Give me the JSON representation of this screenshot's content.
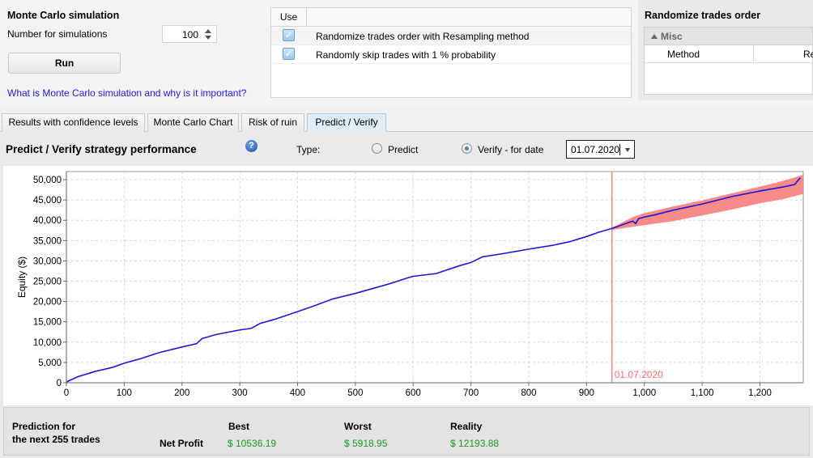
{
  "monte_carlo": {
    "title": "Monte Carlo simulation",
    "num_label": "Number for simulations",
    "num_value": "100",
    "run_label": "Run",
    "link_text": "What is Monte Carlo simulation and why is it important?"
  },
  "use_table": {
    "header_use": "Use",
    "rows": [
      {
        "checked": true,
        "label": "Randomize trades order with Resampling method"
      },
      {
        "checked": true,
        "label": "Randomly skip trades with 1 % probability"
      }
    ]
  },
  "randomize_panel": {
    "title": "Randomize trades order",
    "group": "Misc",
    "property_key": "Method",
    "property_value": "Re"
  },
  "tabs": [
    {
      "label": "Results with confidence levels",
      "active": false
    },
    {
      "label": "Monte Carlo Chart",
      "active": false
    },
    {
      "label": "Risk of ruin",
      "active": false
    },
    {
      "label": "Predict / Verify",
      "active": true
    }
  ],
  "predict": {
    "title": "Predict / Verify strategy performance",
    "help_glyph": "?",
    "type_label": "Type:",
    "option_predict": "Predict",
    "option_verify": "Verify - for date",
    "selected": "verify",
    "date_value": "01.07.2020"
  },
  "chart_data": {
    "type": "area",
    "ylabel": "Equity ($)",
    "xlabel": "",
    "xlim": [
      0,
      1275
    ],
    "ylim": [
      0,
      52000
    ],
    "xticks": [
      0,
      100,
      200,
      300,
      400,
      500,
      600,
      700,
      800,
      900,
      1000,
      1100,
      1200
    ],
    "xtick_labels": [
      "0",
      "100",
      "200",
      "300",
      "400",
      "500",
      "600",
      "700",
      "800",
      "900",
      "1,000",
      "1,100",
      "1,200"
    ],
    "yticks": [
      0,
      5000,
      10000,
      15000,
      20000,
      25000,
      30000,
      35000,
      40000,
      45000,
      50000
    ],
    "ytick_labels": [
      "0",
      "5,000",
      "10,000",
      "15,000",
      "20,000",
      "25,000",
      "30,000",
      "35,000",
      "40,000",
      "45,000",
      "50,000"
    ],
    "grid": true,
    "marker": {
      "x": 944,
      "label": "01.07.2020",
      "color": "#ff6a6a"
    },
    "series": [
      {
        "color": "#1818d6",
        "x": [
          0,
          20,
          50,
          80,
          100,
          130,
          160,
          200,
          225,
          235,
          260,
          300,
          320,
          335,
          360,
          400,
          430,
          460,
          500,
          530,
          560,
          590,
          600,
          640,
          680,
          700,
          720,
          760,
          800,
          840,
          870,
          900,
          920,
          944,
          960,
          980,
          985,
          990,
          1000,
          1020,
          1050,
          1100,
          1150,
          1200,
          1240,
          1260,
          1270
        ],
        "y": [
          200,
          1500,
          2800,
          3800,
          4800,
          6000,
          7400,
          8800,
          9600,
          10900,
          11900,
          13000,
          13400,
          14600,
          15600,
          17500,
          19000,
          20600,
          22000,
          23200,
          24400,
          25800,
          26200,
          26900,
          28800,
          29600,
          31000,
          31900,
          32900,
          33800,
          34700,
          36000,
          37000,
          38000,
          38800,
          39800,
          39200,
          40400,
          40800,
          41400,
          42500,
          44000,
          45800,
          47200,
          48200,
          48800,
          50500
        ]
      }
    ],
    "band": {
      "color": "#f88a8a",
      "x": [
        944,
        980,
        1000,
        1050,
        1100,
        1150,
        1200,
        1240,
        1275
      ],
      "lower": [
        37600,
        38400,
        38800,
        39800,
        41200,
        42600,
        44200,
        45200,
        46500
      ],
      "upper": [
        38200,
        40800,
        41800,
        43400,
        44900,
        46600,
        48300,
        49700,
        51200
      ]
    }
  },
  "summary": {
    "prediction_line1": "Prediction for",
    "prediction_line2": "the next 255 trades",
    "row_label": "Net Profit",
    "best_label": "Best",
    "worst_label": "Worst",
    "reality_label": "Reality",
    "best_value": "$ 10536.19",
    "worst_value": "$ 5918.95",
    "reality_value": "$ 12193.88"
  }
}
